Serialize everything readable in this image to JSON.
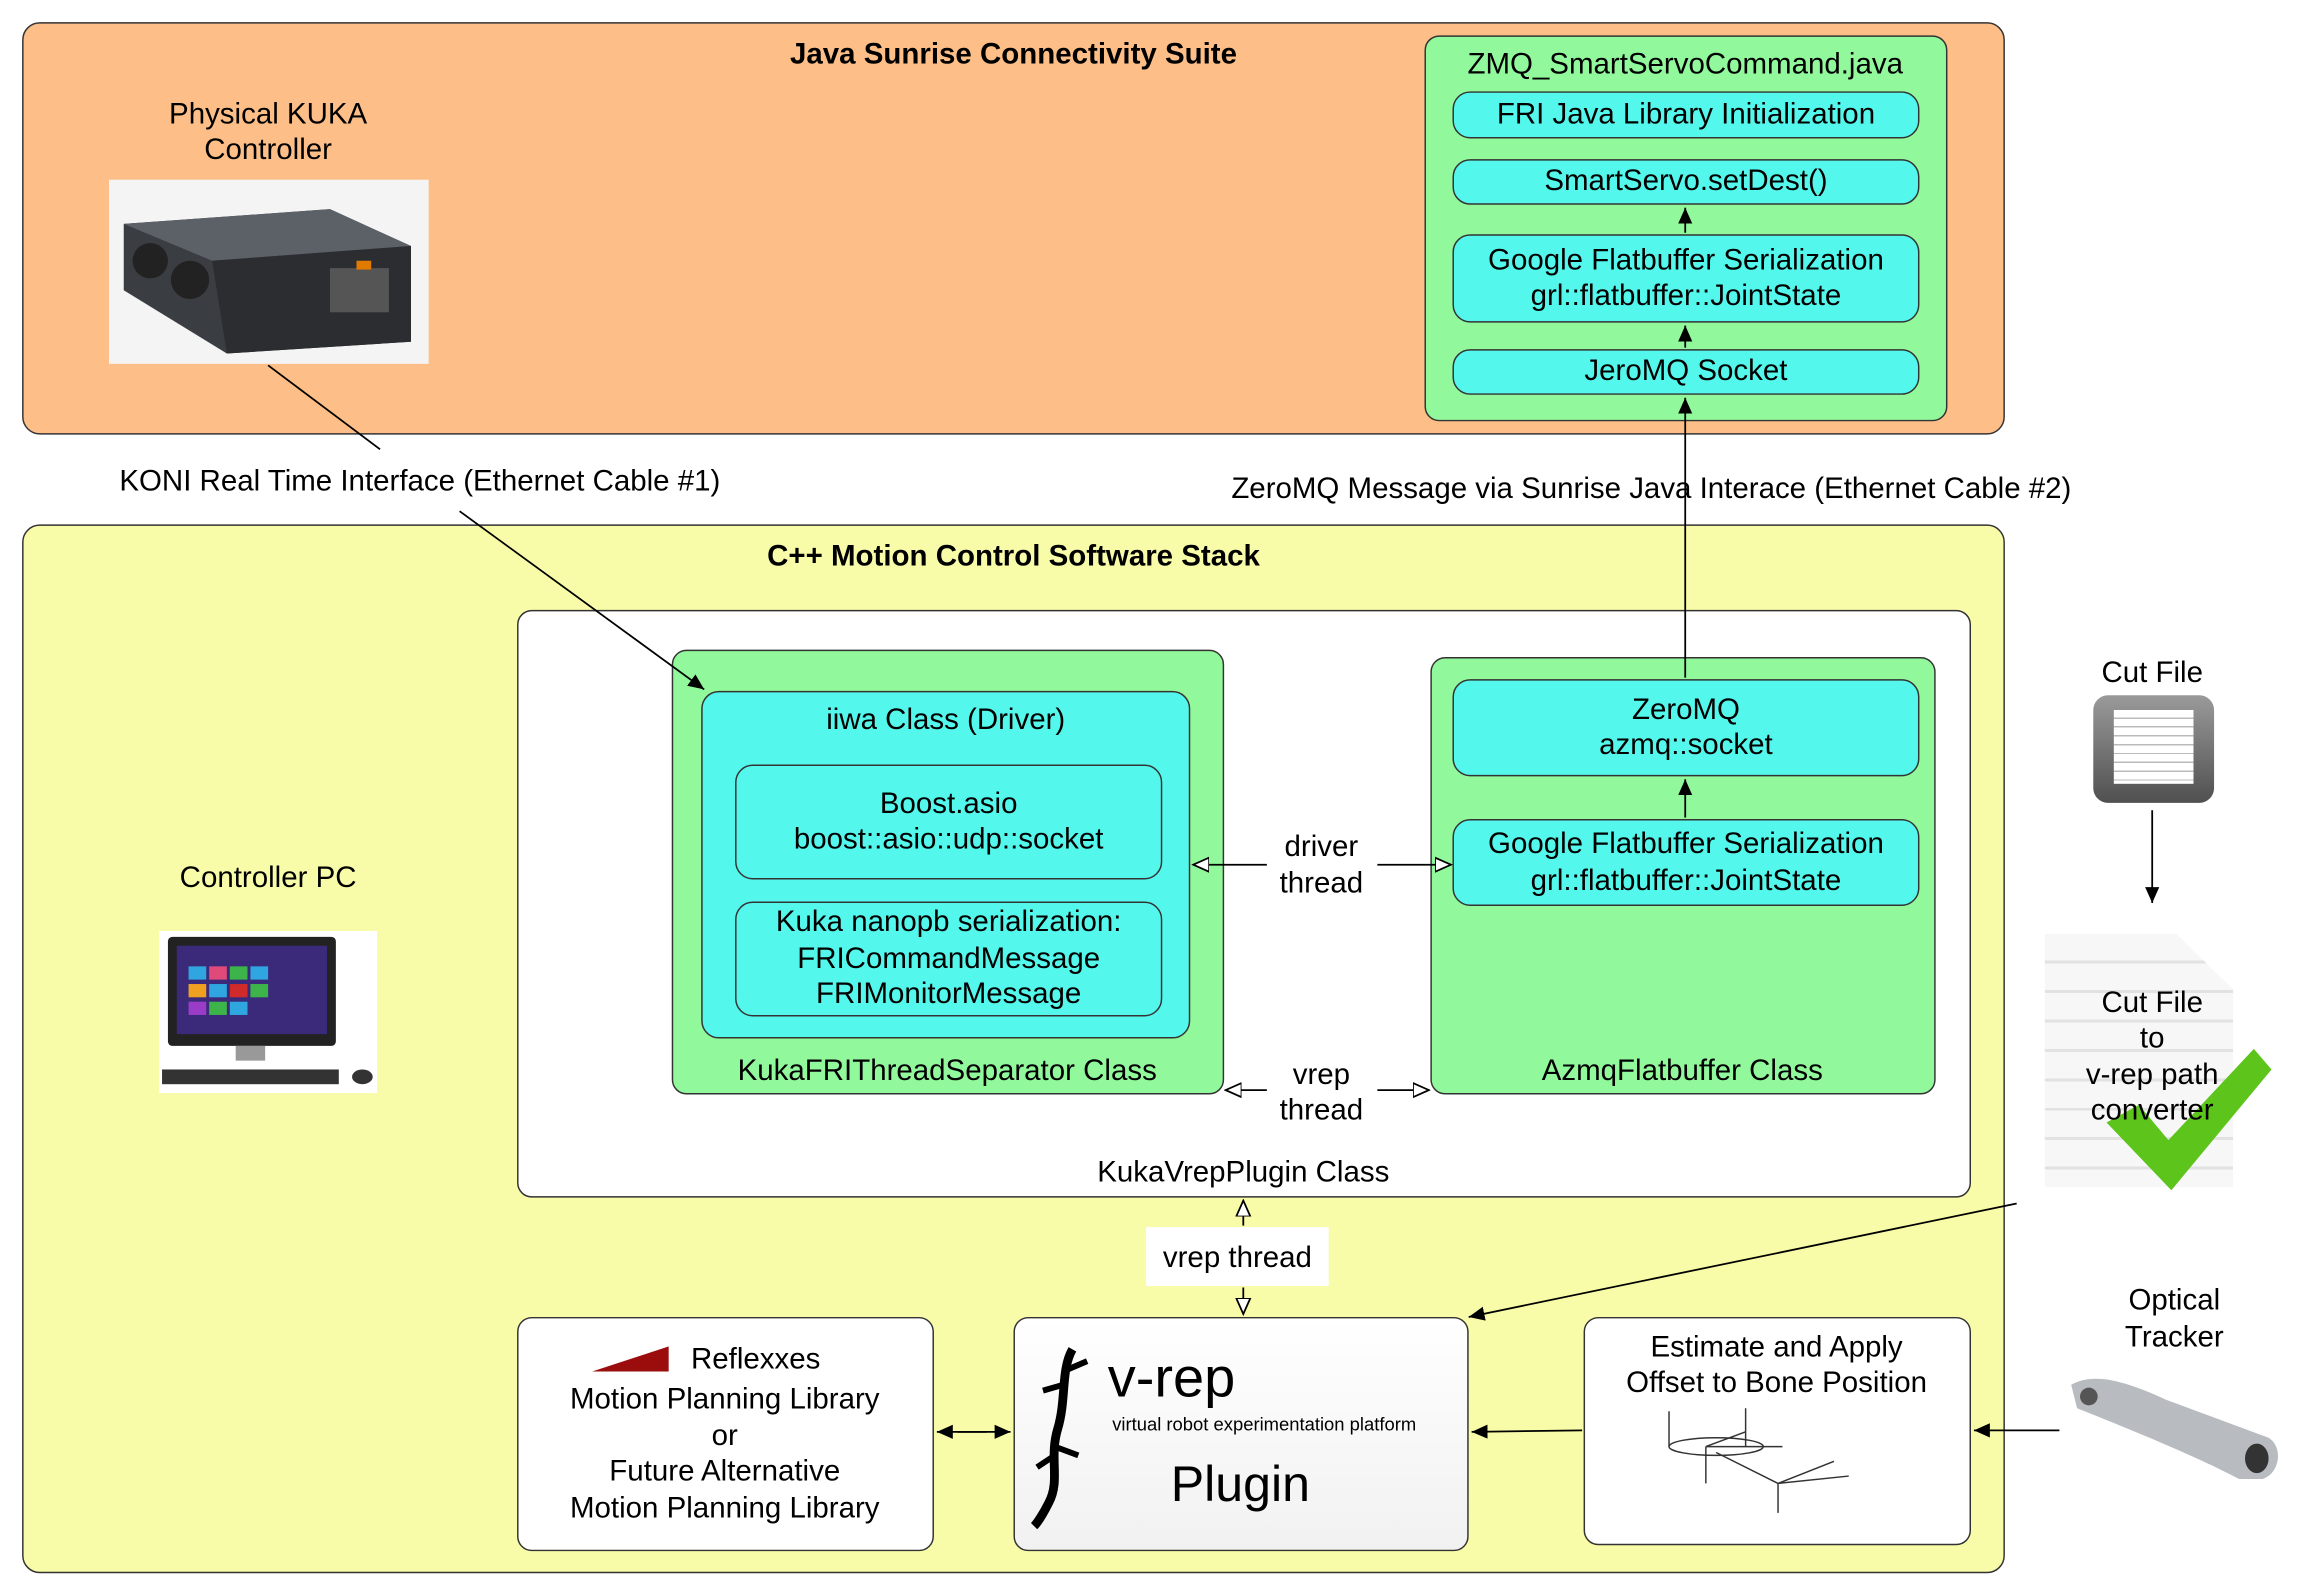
{
  "java_suite": {
    "title": "Java Sunrise Connectivity Suite",
    "kuka_label": [
      "Physical KUKA",
      "Controller"
    ],
    "zmq_box": {
      "title": "ZMQ_SmartServoCommand.java",
      "items": [
        [
          "FRI Java Library Initialization"
        ],
        [
          "SmartServo.setDest()"
        ],
        [
          "Google Flatbuffer Serialization",
          "grl::flatbuffer::JointState"
        ],
        [
          "JeroMQ Socket"
        ]
      ]
    }
  },
  "connections": {
    "koni": "KONI Real Time Interface (Ethernet Cable #1)",
    "zeromq": "ZeroMQ Message via Sunrise Java Interace (Ethernet Cable #2)"
  },
  "cpp_stack": {
    "title": "C++ Motion Control Software Stack",
    "controller_pc": "Controller PC",
    "plugin_class": "KukaVrepPlugin Class",
    "fri_separator": {
      "label": "KukaFRIThreadSeparator Class",
      "iiwa_title": "iiwa Class (Driver)",
      "boost": [
        "Boost.asio",
        "boost::asio::udp::socket"
      ],
      "nanopb": [
        "Kuka nanopb serialization:",
        "FRICommandMessage",
        "FRIMonitorMessage"
      ]
    },
    "azmq": {
      "label": "AzmqFlatbuffer Class",
      "zeromq": [
        "ZeroMQ",
        "azmq::socket"
      ],
      "flatbuffer": [
        "Google Flatbuffer Serialization",
        "grl::flatbuffer::JointState"
      ]
    },
    "driver_thread": [
      "driver",
      "thread"
    ],
    "vrep_thread_inner": [
      "vrep",
      "thread"
    ],
    "vrep_thread": "vrep thread",
    "reflexxes": {
      "logo_text": "Reflexxes",
      "lines": [
        "Motion Planning Library",
        "or",
        "Future Alternative",
        "Motion Planning Library"
      ]
    },
    "vrep": {
      "logo": "v-rep",
      "tagline": "virtual robot experimentation platform",
      "label": "Plugin"
    },
    "estimate": [
      "Estimate and Apply",
      "Offset to Bone Position"
    ]
  },
  "right_side": {
    "cut_file": "Cut File",
    "converter": [
      "Cut File",
      "to",
      "v-rep path",
      "converter"
    ],
    "optical_tracker": [
      "Optical",
      "Tracker"
    ]
  },
  "colors": {
    "java_suite_bg": "#fdbf87",
    "cpp_stack_bg": "#f8fba8",
    "class_bg": "#92f89c",
    "component_bg": "#54f7ec",
    "reflexxes_red": "#9b0d0d",
    "check_green": "#5cc41a"
  }
}
